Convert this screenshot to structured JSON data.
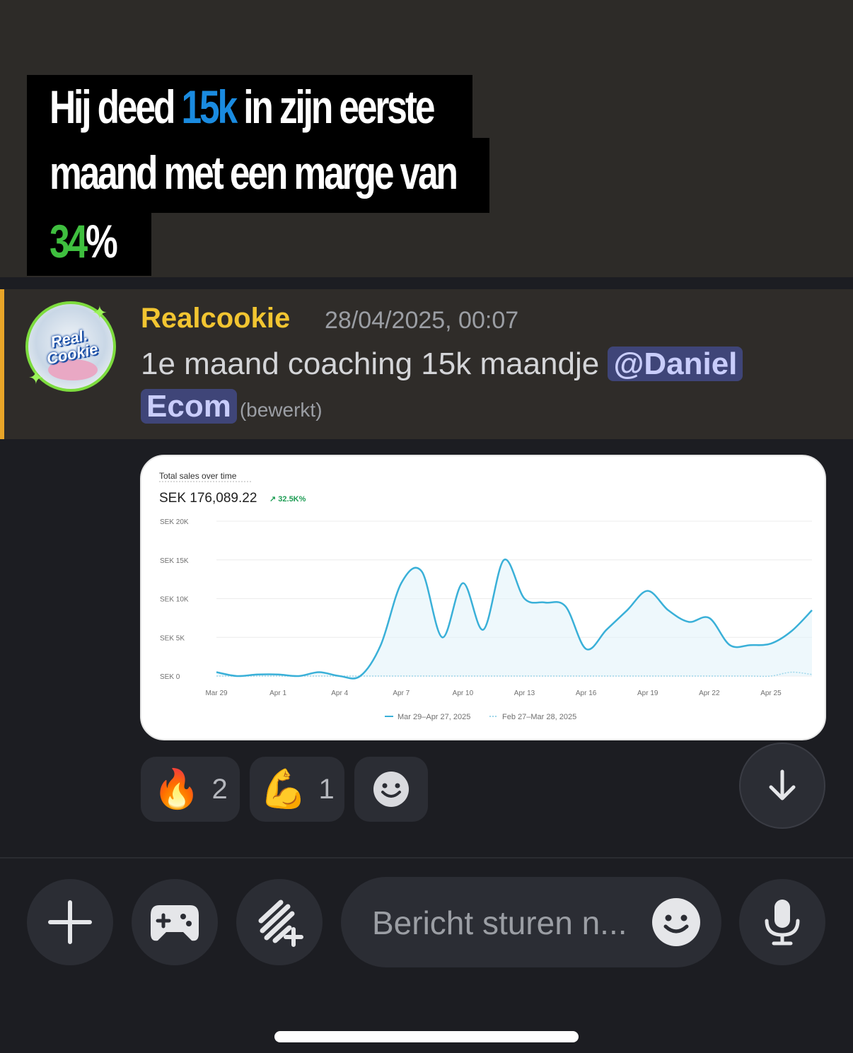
{
  "caption": {
    "line1_a": "Hij deed ",
    "line1_hl": "15k",
    "line1_b": " in zijn eerste",
    "line2": "maand met een marge van",
    "line3_hl": "34",
    "line3_b": "%"
  },
  "message": {
    "username": "Realcookie",
    "timestamp": "28/04/2025, 00:07",
    "text": "1e maand coaching 15k maandje ",
    "mention_part1": "@Daniel",
    "mention_part2": "Ecom",
    "edited": "(bewerkt)",
    "avatar_text": "Real. Cookie"
  },
  "chart_data": {
    "type": "line",
    "title": "Total sales over time",
    "total": "SEK 176,089.22",
    "change": "↗ 32.5K%",
    "y_ticks": [
      "SEK 20K",
      "SEK 15K",
      "SEK 10K",
      "SEK 5K",
      "SEK 0"
    ],
    "ylim": [
      0,
      20000
    ],
    "x_ticks": [
      "Mar 29",
      "Apr 1",
      "Apr 4",
      "Apr 7",
      "Apr 10",
      "Apr 13",
      "Apr 16",
      "Apr 19",
      "Apr 22",
      "Apr 25"
    ],
    "x": [
      "Mar 29",
      "Mar 30",
      "Mar 31",
      "Apr 1",
      "Apr 2",
      "Apr 3",
      "Apr 4",
      "Apr 5",
      "Apr 6",
      "Apr 7",
      "Apr 8",
      "Apr 9",
      "Apr 10",
      "Apr 11",
      "Apr 12",
      "Apr 13",
      "Apr 14",
      "Apr 15",
      "Apr 16",
      "Apr 17",
      "Apr 18",
      "Apr 19",
      "Apr 20",
      "Apr 21",
      "Apr 22",
      "Apr 23",
      "Apr 24",
      "Apr 25",
      "Apr 26",
      "Apr 27"
    ],
    "series": [
      {
        "name": "Mar 29–Apr 27, 2025",
        "color": "#3ab0d8",
        "values": [
          500,
          0,
          200,
          200,
          0,
          500,
          0,
          0,
          4000,
          12000,
          13500,
          5000,
          12000,
          6000,
          15000,
          10000,
          9500,
          9000,
          3500,
          6000,
          8500,
          11000,
          8500,
          7000,
          7500,
          4000,
          4000,
          4200,
          5800,
          8500
        ]
      },
      {
        "name": "Feb 27–Mar 28, 2025",
        "color": "#9ed6ea",
        "values": [
          0,
          0,
          0,
          0,
          0,
          0,
          0,
          0,
          0,
          0,
          0,
          0,
          0,
          0,
          0,
          0,
          0,
          0,
          0,
          0,
          0,
          0,
          0,
          0,
          0,
          0,
          0,
          0,
          500,
          200
        ]
      }
    ],
    "legend_position": "bottom-center",
    "grid": true
  },
  "reactions": [
    {
      "emoji": "🔥",
      "count": "2"
    },
    {
      "emoji": "💪",
      "count": "1"
    }
  ],
  "composer": {
    "placeholder": "Bericht sturen n..."
  },
  "icons": {
    "plus": "plus-icon",
    "game": "gamepad-icon",
    "apps": "apps-icon",
    "smile": "smile-icon",
    "mic": "mic-icon",
    "down": "arrow-down-icon",
    "add_reaction": "add-reaction-icon"
  },
  "colors": {
    "accent_username": "#f2c531",
    "mention_bg": "#3f4578",
    "highlight_blue": "#1a8be0",
    "highlight_green": "#3fbf3f",
    "message_bar": "#e8a528"
  }
}
